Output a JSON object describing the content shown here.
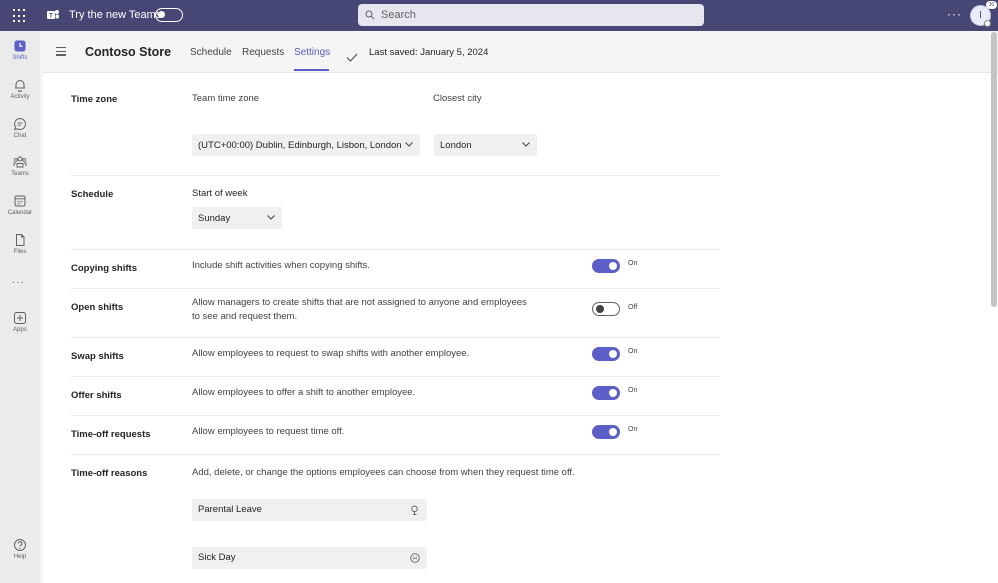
{
  "topbar": {
    "try_label": "Try the new Teams",
    "search_placeholder": "Search",
    "more": "···",
    "avatar_initial": "I",
    "avatar_badge": "30"
  },
  "rail": {
    "items": [
      {
        "label": "Shifts",
        "icon": "shifts-icon"
      },
      {
        "label": "Activity",
        "icon": "bell-icon"
      },
      {
        "label": "Chat",
        "icon": "chat-icon"
      },
      {
        "label": "Teams",
        "icon": "teams-icon"
      },
      {
        "label": "Calendar",
        "icon": "calendar-icon"
      },
      {
        "label": "Files",
        "icon": "file-icon"
      },
      {
        "label": "Apps",
        "icon": "apps-icon"
      },
      {
        "label": "Help",
        "icon": "help-icon"
      }
    ],
    "more": "···"
  },
  "header": {
    "title": "Contoso Store",
    "tabs": [
      {
        "label": "Schedule",
        "active": false
      },
      {
        "label": "Requests",
        "active": false
      },
      {
        "label": "Settings",
        "active": true
      }
    ],
    "last_saved": "Last saved: January 5, 2024"
  },
  "settings": {
    "time_zone": {
      "label": "Time zone",
      "team_time_zone_label": "Team time zone",
      "team_time_zone_value": "(UTC+00:00) Dublin, Edinburgh, Lisbon, London",
      "closest_city_label": "Closest city",
      "closest_city_value": "London"
    },
    "schedule": {
      "label": "Schedule",
      "start_of_week_label": "Start of week",
      "start_of_week_value": "Sunday"
    },
    "copying_shifts": {
      "label": "Copying shifts",
      "description": "Include shift activities when copying shifts.",
      "state": "On"
    },
    "open_shifts": {
      "label": "Open shifts",
      "description_line1": "Allow managers to create shifts that are not assigned to anyone and employees",
      "description_line2": "to see and request them.",
      "state": "Off"
    },
    "swap_shifts": {
      "label": "Swap shifts",
      "description": "Allow employees to request to swap shifts with another employee.",
      "state": "On"
    },
    "offer_shifts": {
      "label": "Offer shifts",
      "description": "Allow employees to offer a shift to another employee.",
      "state": "On"
    },
    "time_off_requests": {
      "label": "Time-off requests",
      "description": "Allow employees to request time off.",
      "state": "On"
    },
    "time_off_reasons": {
      "label": "Time-off reasons",
      "description": "Add, delete, or change the options employees can choose from when they request time off.",
      "reasons": [
        {
          "name": "Parental Leave",
          "icon": "pin-icon"
        },
        {
          "name": "Sick Day",
          "icon": "sick-icon"
        }
      ]
    }
  },
  "colors": {
    "topbar": "#464775",
    "accent": "#5b5fc7"
  }
}
